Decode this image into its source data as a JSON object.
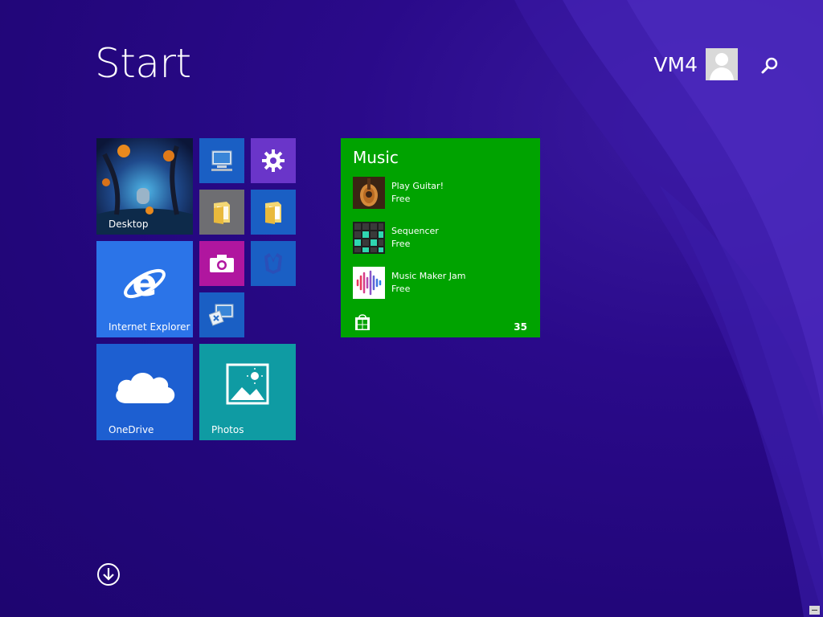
{
  "screen": {
    "title": "Start",
    "user_name": "VM4"
  },
  "tiles": {
    "desktop": "Desktop",
    "internet_explorer": "Internet Explorer",
    "onedrive": "OneDrive",
    "photos": "Photos"
  },
  "music": {
    "title": "Music",
    "apps": [
      {
        "name": "Play Guitar!",
        "price": "Free"
      },
      {
        "name": "Sequencer",
        "price": "Free"
      },
      {
        "name": "Music Maker Jam",
        "price": "Free"
      }
    ],
    "badge": "35"
  },
  "colors": {
    "background": "#22067a",
    "music_tile": "#00a300",
    "ie_tile": "#2b74e8",
    "onedrive_tile": "#1d5fd1",
    "photos_tile": "#0f9ba3",
    "settings_tile": "#6a35c9",
    "camera_tile": "#b0169f"
  },
  "icons": [
    "search-icon",
    "user-avatar-icon",
    "gear-icon",
    "computer-icon",
    "folder-icon",
    "camera-icon",
    "malwarebytes-icon",
    "remote-desktop-icon",
    "internet-explorer-icon",
    "cloud-icon",
    "photo-icon",
    "store-icon",
    "down-arrow-icon"
  ]
}
